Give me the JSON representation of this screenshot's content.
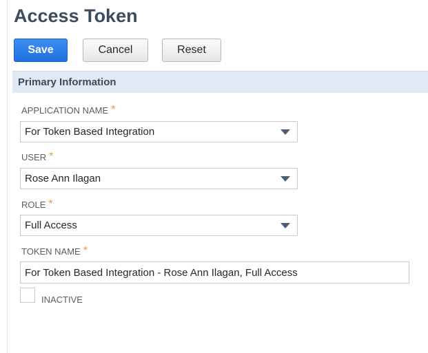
{
  "page": {
    "title": "Access Token"
  },
  "toolbar": {
    "save_label": "Save",
    "cancel_label": "Cancel",
    "reset_label": "Reset"
  },
  "section": {
    "title": "Primary Information"
  },
  "fields": {
    "application_name": {
      "label": "APPLICATION NAME",
      "required_mark": "*",
      "value": "For Token Based Integration"
    },
    "user": {
      "label": "USER",
      "required_mark": "*",
      "value": "Rose Ann Ilagan"
    },
    "role": {
      "label": "ROLE",
      "required_mark": "*",
      "value": "Full Access"
    },
    "token_name": {
      "label": "TOKEN NAME",
      "required_mark": "*",
      "value": "For Token Based Integration - Rose Ann Ilagan, Full Access"
    },
    "inactive": {
      "label": "INACTIVE",
      "checked": false
    }
  },
  "colors": {
    "primary_button": "#2a7de9",
    "title_text": "#3d4b61",
    "section_bar": "#e1e9f4",
    "required_mark": "#e0a030"
  }
}
